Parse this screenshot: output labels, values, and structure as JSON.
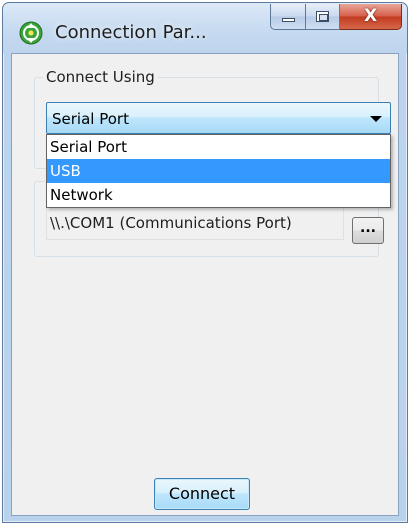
{
  "window": {
    "title": "Connection Par...",
    "icon": "connection-parameters-icon",
    "close_glyph": "X"
  },
  "connect_using": {
    "label": "Connect Using",
    "selected_value": "Serial Port",
    "options": [
      "Serial Port",
      "USB",
      "Network"
    ],
    "highlighted_option": "USB"
  },
  "port": {
    "value": "\\\\.\\COM1 (Communications Port)",
    "browse_label": "..."
  },
  "actions": {
    "connect_label": "Connect"
  },
  "colors": {
    "highlight": "#3399ff",
    "close_button": "#c23b22",
    "dialog_background": "#f0f0f0"
  }
}
